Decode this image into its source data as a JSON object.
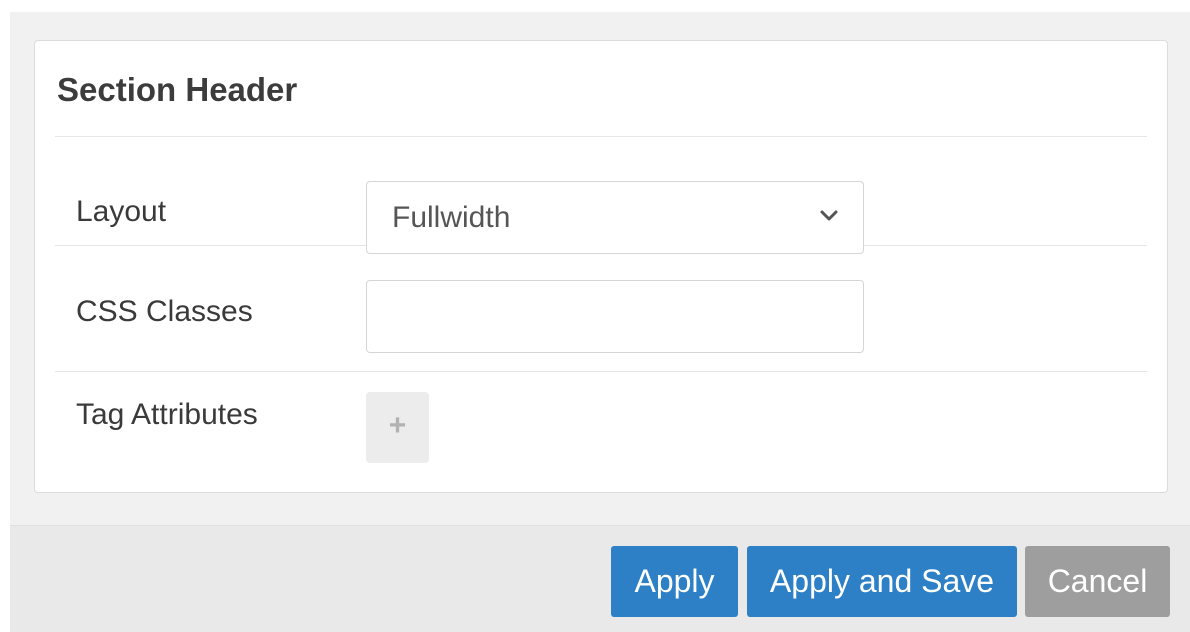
{
  "section": {
    "title": "Section Header"
  },
  "fields": {
    "layout": {
      "label": "Layout",
      "selected": "Fullwidth"
    },
    "css_classes": {
      "label": "CSS Classes",
      "value": ""
    },
    "tag_attributes": {
      "label": "Tag Attributes",
      "add_symbol": "+"
    }
  },
  "footer": {
    "apply_label": "Apply",
    "apply_save_label": "Apply and Save",
    "cancel_label": "Cancel"
  },
  "colors": {
    "primary": "#2d80c6",
    "cancel": "#9e9e9e",
    "panel_bg": "#ffffff",
    "dialog_bg": "#f1f1f1"
  },
  "icons": {
    "select_arrow": "chevron-down-icon",
    "add": "plus-icon"
  }
}
